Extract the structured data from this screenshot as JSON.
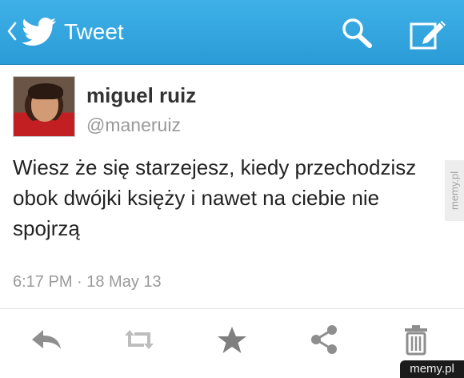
{
  "header": {
    "title": "Tweet",
    "back_icon": "chevron-left-icon",
    "logo_icon": "twitter-bird-icon",
    "search_icon": "search-icon",
    "compose_icon": "compose-icon"
  },
  "tweet": {
    "display_name": "miguel ruiz",
    "handle": "@maneruiz",
    "text": "Wiesz że się starzejesz, kiedy przechodzisz obok dwójki księży i nawet na ciebie nie spojrzą",
    "timestamp": "6:17 PM · 18 May 13"
  },
  "actions": [
    {
      "name": "reply-icon"
    },
    {
      "name": "retweet-icon"
    },
    {
      "name": "favorite-star-icon"
    },
    {
      "name": "share-icon"
    },
    {
      "name": "delete-trash-icon"
    }
  ],
  "watermarks": {
    "side": "memy.pl",
    "corner": "memy.pl"
  },
  "colors": {
    "header_blue": "#2a9bd6",
    "icon_gray": "#8e8e8e"
  }
}
